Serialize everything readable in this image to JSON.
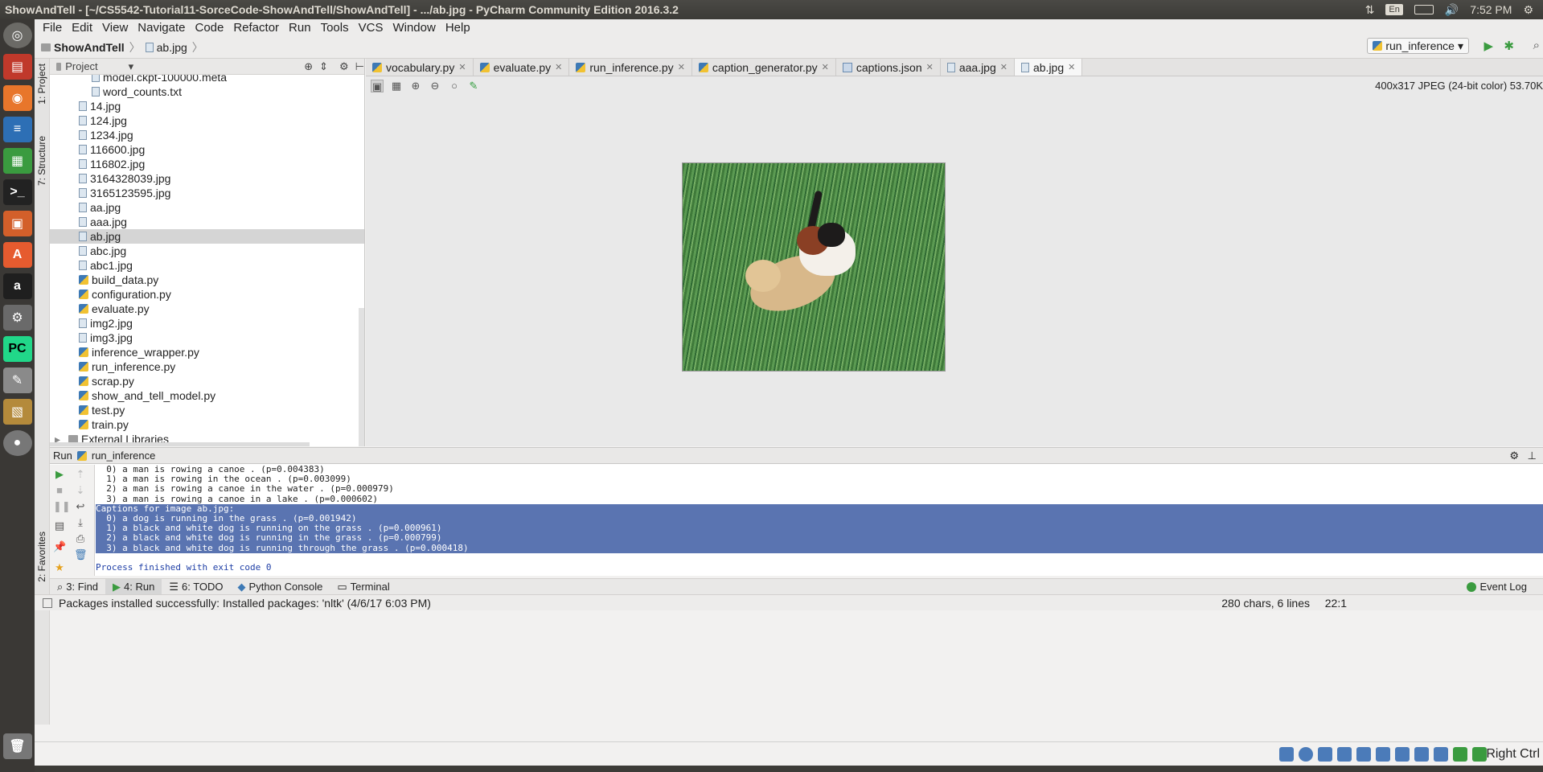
{
  "os": {
    "window_title": "ShowAndTell - [~/CS5542-Tutorial11-SorceCode-ShowAndTell/ShowAndTell] - .../ab.jpg - PyCharm Community Edition 2016.3.2",
    "lang": "En",
    "clock": "7:52 PM",
    "right_ctrl": "Right Ctrl"
  },
  "menu": [
    "File",
    "Edit",
    "View",
    "Navigate",
    "Code",
    "Refactor",
    "Run",
    "Tools",
    "VCS",
    "Window",
    "Help"
  ],
  "breadcrumb": {
    "project": "ShowAndTell",
    "file": "ab.jpg"
  },
  "run_config": "run_inference",
  "side_tabs": {
    "project": "1: Project",
    "structure": "7: Structure",
    "favorites": "2: Favorites"
  },
  "project_panel": {
    "title": "Project",
    "files": [
      {
        "name": "model.ckpt-100000.meta",
        "kind": "file",
        "indent": 2
      },
      {
        "name": "word_counts.txt",
        "kind": "file",
        "indent": 2
      },
      {
        "name": "14.jpg",
        "kind": "img",
        "indent": 1
      },
      {
        "name": "124.jpg",
        "kind": "img",
        "indent": 1
      },
      {
        "name": "1234.jpg",
        "kind": "img",
        "indent": 1
      },
      {
        "name": "116600.jpg",
        "kind": "img",
        "indent": 1
      },
      {
        "name": "116802.jpg",
        "kind": "img",
        "indent": 1
      },
      {
        "name": "3164328039.jpg",
        "kind": "img",
        "indent": 1
      },
      {
        "name": "3165123595.jpg",
        "kind": "img",
        "indent": 1
      },
      {
        "name": "aa.jpg",
        "kind": "img",
        "indent": 1
      },
      {
        "name": "aaa.jpg",
        "kind": "img",
        "indent": 1
      },
      {
        "name": "ab.jpg",
        "kind": "img",
        "indent": 1,
        "selected": true
      },
      {
        "name": "abc.jpg",
        "kind": "img",
        "indent": 1
      },
      {
        "name": "abc1.jpg",
        "kind": "img",
        "indent": 1
      },
      {
        "name": "build_data.py",
        "kind": "py",
        "indent": 1
      },
      {
        "name": "configuration.py",
        "kind": "py",
        "indent": 1
      },
      {
        "name": "evaluate.py",
        "kind": "py",
        "indent": 1
      },
      {
        "name": "img2.jpg",
        "kind": "img",
        "indent": 1
      },
      {
        "name": "img3.jpg",
        "kind": "img",
        "indent": 1
      },
      {
        "name": "inference_wrapper.py",
        "kind": "py",
        "indent": 1
      },
      {
        "name": "run_inference.py",
        "kind": "py",
        "indent": 1
      },
      {
        "name": "scrap.py",
        "kind": "py",
        "indent": 1
      },
      {
        "name": "show_and_tell_model.py",
        "kind": "py",
        "indent": 1
      },
      {
        "name": "test.py",
        "kind": "py",
        "indent": 1
      },
      {
        "name": "train.py",
        "kind": "py",
        "indent": 1
      },
      {
        "name": "External Libraries",
        "kind": "lib",
        "indent": 0
      }
    ]
  },
  "editor_tabs": [
    {
      "label": "vocabulary.py",
      "kind": "py"
    },
    {
      "label": "evaluate.py",
      "kind": "py"
    },
    {
      "label": "run_inference.py",
      "kind": "py"
    },
    {
      "label": "caption_generator.py",
      "kind": "py"
    },
    {
      "label": "captions.json",
      "kind": "json"
    },
    {
      "label": "aaa.jpg",
      "kind": "img"
    },
    {
      "label": "ab.jpg",
      "kind": "img",
      "active": true
    }
  ],
  "image_info": "400x317 JPEG (24-bit color) 53.70K",
  "run_panel": {
    "label": "Run",
    "config": "run_inference",
    "lines": [
      {
        "text": "  0) a man is rowing a canoe . (p=0.004383)",
        "style": ""
      },
      {
        "text": "  1) a man is rowing in the ocean . (p=0.003099)",
        "style": ""
      },
      {
        "text": "  2) a man is rowing a canoe in the water . (p=0.000979)",
        "style": ""
      },
      {
        "text": "  3) a man is rowing a canoe in a lake . (p=0.000602)",
        "style": ""
      },
      {
        "text": "Captions for image ab.jpg:",
        "style": "hl"
      },
      {
        "text": "  0) a dog is running in the grass . (p=0.001942)",
        "style": "hl"
      },
      {
        "text": "  1) a black and white dog is running on the grass . (p=0.000961)",
        "style": "hl"
      },
      {
        "text": "  2) a black and white dog is running in the grass . (p=0.000799)",
        "style": "hl"
      },
      {
        "text": "  3) a black and white dog is running through the grass . (p=0.000418)",
        "style": "hl"
      },
      {
        "text": "",
        "style": ""
      },
      {
        "text": "Process finished with exit code 0",
        "style": "out"
      }
    ]
  },
  "tool_tabs": [
    {
      "label": "3: Find",
      "icon": "search-icon"
    },
    {
      "label": "4: Run",
      "icon": "play-icon",
      "active": true
    },
    {
      "label": "6: TODO",
      "icon": "todo-icon"
    },
    {
      "label": "Python Console",
      "icon": "python-icon"
    },
    {
      "label": "Terminal",
      "icon": "terminal-icon"
    }
  ],
  "event_log": "Event Log",
  "status": {
    "message": "Packages installed successfully: Installed packages: 'nltk' (4/6/17 6:03 PM)",
    "chars": "280 chars, 6 lines",
    "position": "22:1"
  },
  "colors": {
    "selection": "#5a74b1",
    "launcher_bg": "#3a3835",
    "pycharm_green": "#21d789"
  }
}
